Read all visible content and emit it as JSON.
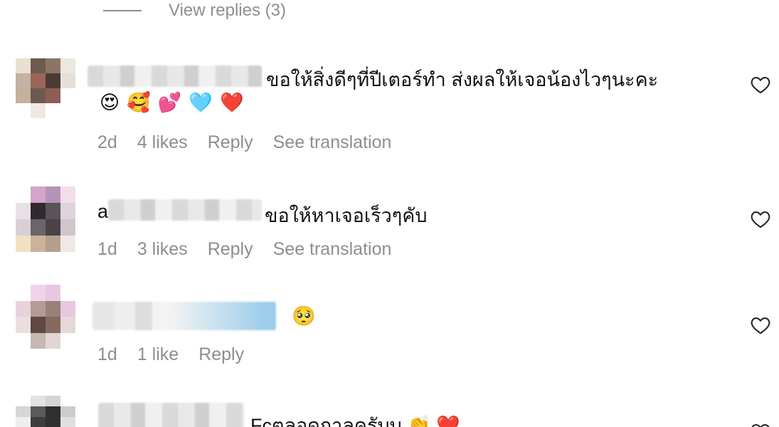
{
  "view_replies": {
    "label": "View replies (3)"
  },
  "comments": [
    {
      "text": "ขอให้สิ่งดีๆที่ปีเตอร์ทำ ส่งผลให้เจอน้องไวๆนะคะ",
      "emojis": "😍🥰💕🩵❤️",
      "time": "2d",
      "likes": "4 likes",
      "reply": "Reply",
      "translate": "See translation"
    },
    {
      "prefix": "a",
      "text": "ขอให้หาเจอเร็วๆคับ",
      "time": "1d",
      "likes": "3 likes",
      "reply": "Reply",
      "translate": "See translation"
    },
    {
      "text": "🥺",
      "time": "1d",
      "likes": "1 like",
      "reply": "Reply"
    },
    {
      "text": "Fcตลอดกาลครับบ 👏 ❤️"
    }
  ],
  "colors": {
    "meta_gray": "#8e8e8e",
    "text": "#111111",
    "background": "#ffffff"
  },
  "icons": {
    "like": "heart-outline-icon"
  }
}
